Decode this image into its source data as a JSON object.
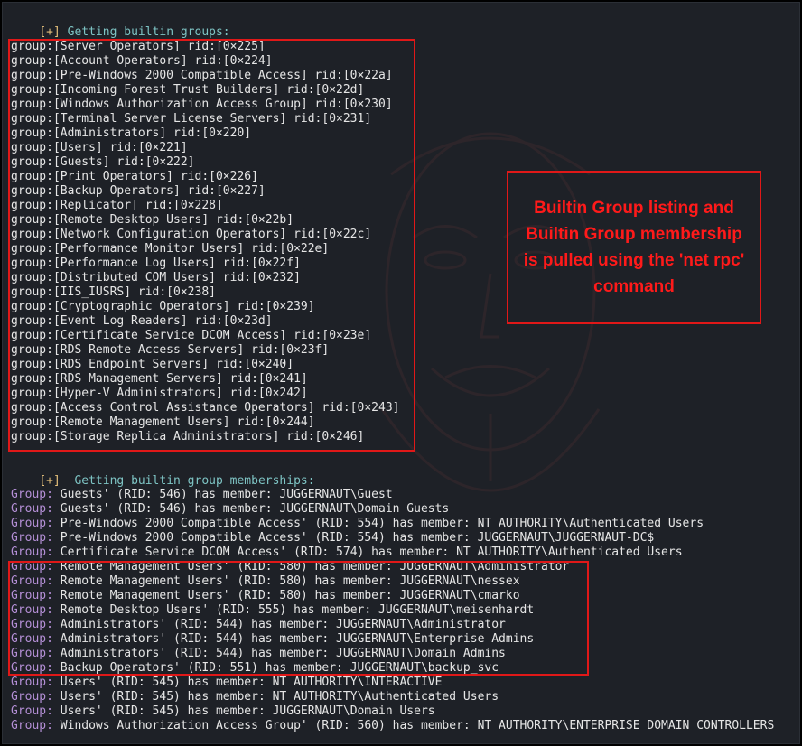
{
  "terminal": {
    "groups_header": {
      "bracket": "[+]",
      "text": "Getting builtin groups:"
    },
    "groups": [
      "group:[Server Operators] rid:[0×225]",
      "group:[Account Operators] rid:[0×224]",
      "group:[Pre-Windows 2000 Compatible Access] rid:[0×22a]",
      "group:[Incoming Forest Trust Builders] rid:[0×22d]",
      "group:[Windows Authorization Access Group] rid:[0×230]",
      "group:[Terminal Server License Servers] rid:[0×231]",
      "group:[Administrators] rid:[0×220]",
      "group:[Users] rid:[0×221]",
      "group:[Guests] rid:[0×222]",
      "group:[Print Operators] rid:[0×226]",
      "group:[Backup Operators] rid:[0×227]",
      "group:[Replicator] rid:[0×228]",
      "group:[Remote Desktop Users] rid:[0×22b]",
      "group:[Network Configuration Operators] rid:[0×22c]",
      "group:[Performance Monitor Users] rid:[0×22e]",
      "group:[Performance Log Users] rid:[0×22f]",
      "group:[Distributed COM Users] rid:[0×232]",
      "group:[IIS_IUSRS] rid:[0×238]",
      "group:[Cryptographic Operators] rid:[0×239]",
      "group:[Event Log Readers] rid:[0×23d]",
      "group:[Certificate Service DCOM Access] rid:[0×23e]",
      "group:[RDS Remote Access Servers] rid:[0×23f]",
      "group:[RDS Endpoint Servers] rid:[0×240]",
      "group:[RDS Management Servers] rid:[0×241]",
      "group:[Hyper-V Administrators] rid:[0×242]",
      "group:[Access Control Assistance Operators] rid:[0×243]",
      "group:[Remote Management Users] rid:[0×244]",
      "group:[Storage Replica Administrators] rid:[0×246]"
    ],
    "memberships_header": {
      "bracket": "[+]",
      "text": " Getting builtin group memberships:"
    },
    "memberships": [
      {
        "prefix": "Group:",
        "text": " Guests' (RID: 546) has member: JUGGERNAUT\\Guest"
      },
      {
        "prefix": "Group:",
        "text": " Guests' (RID: 546) has member: JUGGERNAUT\\Domain Guests"
      },
      {
        "prefix": "Group:",
        "text": " Pre-Windows 2000 Compatible Access' (RID: 554) has member: NT AUTHORITY\\Authenticated Users"
      },
      {
        "prefix": "Group:",
        "text": " Pre-Windows 2000 Compatible Access' (RID: 554) has member: JUGGERNAUT\\JUGGERNAUT-DC$"
      },
      {
        "prefix": "Group:",
        "text": " Certificate Service DCOM Access' (RID: 574) has member: NT AUTHORITY\\Authenticated Users"
      },
      {
        "prefix": "Group:",
        "text": " Remote Management Users' (RID: 580) has member: JUGGERNAUT\\Administrator"
      },
      {
        "prefix": "Group:",
        "text": " Remote Management Users' (RID: 580) has member: JUGGERNAUT\\nessex"
      },
      {
        "prefix": "Group:",
        "text": " Remote Management Users' (RID: 580) has member: JUGGERNAUT\\cmarko"
      },
      {
        "prefix": "Group:",
        "text": " Remote Desktop Users' (RID: 555) has member: JUGGERNAUT\\meisenhardt"
      },
      {
        "prefix": "Group:",
        "text": " Administrators' (RID: 544) has member: JUGGERNAUT\\Administrator"
      },
      {
        "prefix": "Group:",
        "text": " Administrators' (RID: 544) has member: JUGGERNAUT\\Enterprise Admins"
      },
      {
        "prefix": "Group:",
        "text": " Administrators' (RID: 544) has member: JUGGERNAUT\\Domain Admins"
      },
      {
        "prefix": "Group:",
        "text": " Backup Operators' (RID: 551) has member: JUGGERNAUT\\backup_svc"
      },
      {
        "prefix": "Group:",
        "text": " Users' (RID: 545) has member: NT AUTHORITY\\INTERACTIVE"
      },
      {
        "prefix": "Group:",
        "text": " Users' (RID: 545) has member: NT AUTHORITY\\Authenticated Users"
      },
      {
        "prefix": "Group:",
        "text": " Users' (RID: 545) has member: JUGGERNAUT\\Domain Users"
      },
      {
        "prefix": "Group:",
        "text": " Windows Authorization Access Group' (RID: 560) has member: NT AUTHORITY\\ENTERPRISE DOMAIN CONTROLLERS"
      }
    ]
  },
  "annotation": {
    "callout_text": "Builtin Group listing and Builtin Group membership is pulled using the 'net rpc' command"
  },
  "colors": {
    "background": "#1e2127",
    "text": "#e6e6e6",
    "bracket": "#e5c07b",
    "header": "#7ec4c4",
    "group_prefix": "#b48fd6",
    "highlight": "#e01818"
  },
  "icons": {
    "watermark": "guy-fawkes-mask-icon"
  }
}
